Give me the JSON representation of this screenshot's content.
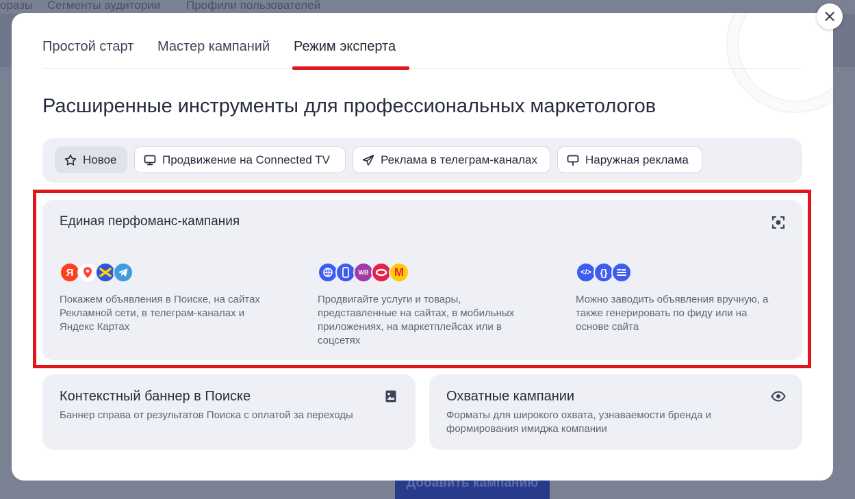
{
  "background": {
    "nav": [
      "оразы",
      "Сегменты аудитории",
      "Профили пользователей"
    ],
    "add_button": "Добавить кампанию"
  },
  "modal": {
    "tabs": [
      {
        "label": "Простой старт"
      },
      {
        "label": "Мастер кампаний"
      },
      {
        "label": "Режим эксперта"
      }
    ],
    "active_tab": "Режим эксперта",
    "title": "Расширенные инструменты для профессиональных маркетологов",
    "chips": [
      {
        "label": "Новое",
        "icon": "star-icon"
      },
      {
        "label": "Продвижение на Connected TV",
        "icon": "tv-icon"
      },
      {
        "label": "Реклама в телеграм-каналах",
        "icon": "send-icon"
      },
      {
        "label": "Наружная реклама",
        "icon": "billboard-icon"
      }
    ],
    "performance_card": {
      "title": "Единая перфоманс-кампания",
      "columns": [
        {
          "text": "Покажем объявления в Поиске, на сайтах Рекламной сети, в телеграм-каналах и Яндекс Картах"
        },
        {
          "text": "Продвигайте услуги и товары, представленные на сайтах, в мобильных приложениях, на маркетплейсах или в соцсетях"
        },
        {
          "text": "Можно заводить объявления вручную, а также генерировать по фиду или на основе сайта"
        }
      ]
    },
    "banner_card": {
      "title": "Контекстный баннер в Поиске",
      "desc": "Баннер справа от результатов Поиска с оплатой за переходы"
    },
    "reach_card": {
      "title": "Охватные кампании",
      "desc": "Форматы для широкого охвата, узнаваемости бренда и формирования имиджа компании"
    }
  },
  "colors": {
    "accent_red": "#e0161d",
    "card_bg": "#eef0f5",
    "icon_blue": "#3f5cf0"
  }
}
